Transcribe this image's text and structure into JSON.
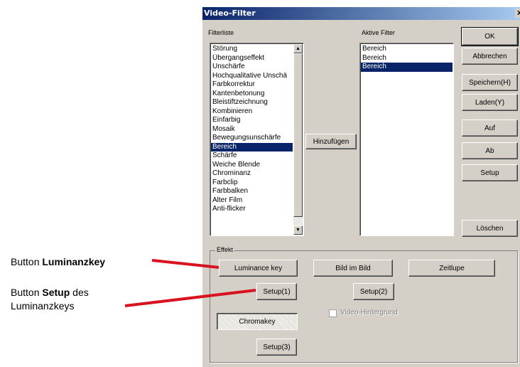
{
  "dialog": {
    "title": "Video-Filter",
    "close_glyph": "x"
  },
  "filterliste": {
    "label": "Filterliste",
    "items": [
      "Störung",
      "Übergangseffekt",
      "Unschärfe",
      "Hochqualitative Unschä",
      "Farbkorrektur",
      "Kantenbetonung",
      "Bleistiftzeichnung",
      "Kombinieren",
      "Einfarbig",
      "Mosaik",
      "Bewegungsunschärfe",
      "Bereich",
      "Schärfe",
      "Weiche Blende",
      "Chrominanz",
      "Farbclip",
      "Farbbalken",
      "Alter Film",
      "Anti-flicker"
    ],
    "selected_index": 11,
    "scroll_up_glyph": "▲",
    "scroll_down_glyph": "▼"
  },
  "hinzufuegen_label": "Hinzufügen",
  "aktive_filter": {
    "label": "Aktive Filter",
    "items": [
      "Bereich",
      "Bereich",
      "Bereich"
    ],
    "selected_index": 2
  },
  "buttons": {
    "ok": "OK",
    "abbrechen": "Abbrechen",
    "speichern": "Speichern(H)",
    "laden": "Laden(Y)",
    "auf": "Auf",
    "ab": "Ab",
    "setup": "Setup",
    "loeschen": "Löschen"
  },
  "effekt": {
    "label": "Effekt",
    "luminance_key": "Luminance key",
    "bild_im_bild": "Bild im Bild",
    "zeitlupe": "Zeitlupe",
    "setup1": "Setup(1)",
    "setup2": "Setup(2)",
    "chromakey": "Chromakey",
    "setup3": "Setup(3)",
    "video_hintergrund": "Video-Hintergrund"
  },
  "annotations": {
    "a1_prefix": "Button ",
    "a1_bold": "Luminanzkey",
    "a2_prefix": "Button ",
    "a2_bold": "Setup",
    "a2_suffix": " des",
    "a2_line2": "Luminanzkeys",
    "line_color": "#d8121e"
  }
}
